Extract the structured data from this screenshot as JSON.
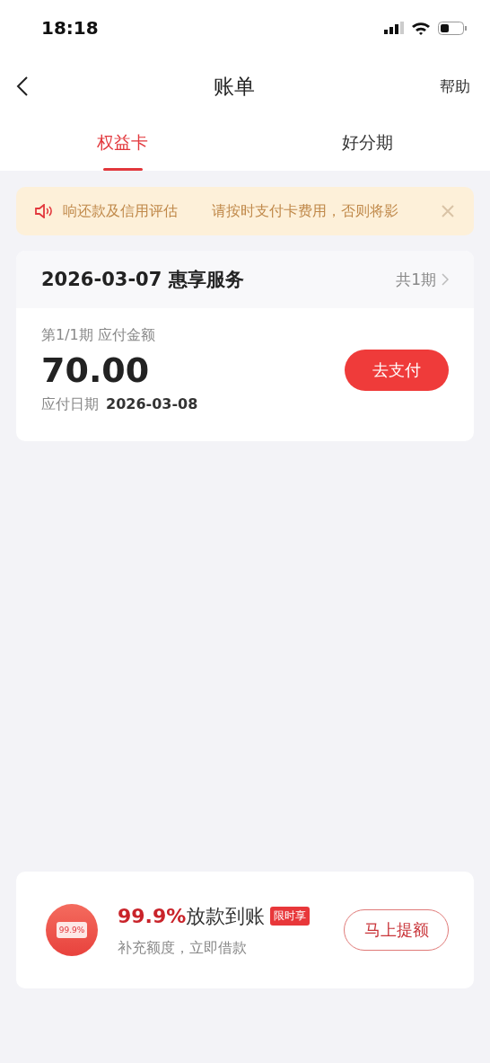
{
  "status_bar": {
    "time": "18:18"
  },
  "header": {
    "title": "账单",
    "help": "帮助"
  },
  "tabs": [
    {
      "label": "权益卡",
      "selected": true
    },
    {
      "label": "好分期",
      "selected": false
    }
  ],
  "notice": {
    "texts": [
      "响还款及信用评估",
      "请按时支付卡费用，否则将影"
    ]
  },
  "bill": {
    "title": "2026-03-07 惠享服务",
    "periods": "共1期",
    "installment_label": "第1/1期 应付金额",
    "amount": "70.00",
    "due_label": "应付日期",
    "due_date": "2026-03-08",
    "pay_button": "去支付"
  },
  "promo": {
    "icon_label": "99.9%",
    "highlight": "99.9%",
    "title": "放款到账",
    "tag": "限时享",
    "subtitle": "补充额度，立即借款",
    "button": "马上提额"
  }
}
